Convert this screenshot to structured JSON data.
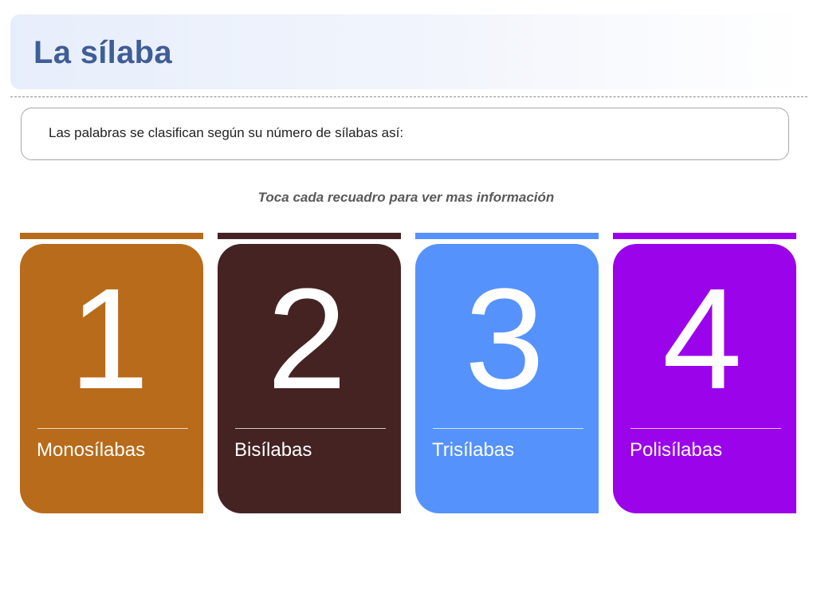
{
  "header": {
    "title": "La sílaba"
  },
  "intro": {
    "text": "Las palabras se clasifican según su número de sílabas así:"
  },
  "hint": "Toca cada recuadro para ver mas información",
  "cards": [
    {
      "number": "1",
      "label": "Monosílabas",
      "color": "#b86b1a"
    },
    {
      "number": "2",
      "label": "Bisílabas",
      "color": "#452323"
    },
    {
      "number": "3",
      "label": "Trisílabas",
      "color": "#5592fb"
    },
    {
      "number": "4",
      "label": "Polisílabas",
      "color": "#9b03eb"
    }
  ]
}
